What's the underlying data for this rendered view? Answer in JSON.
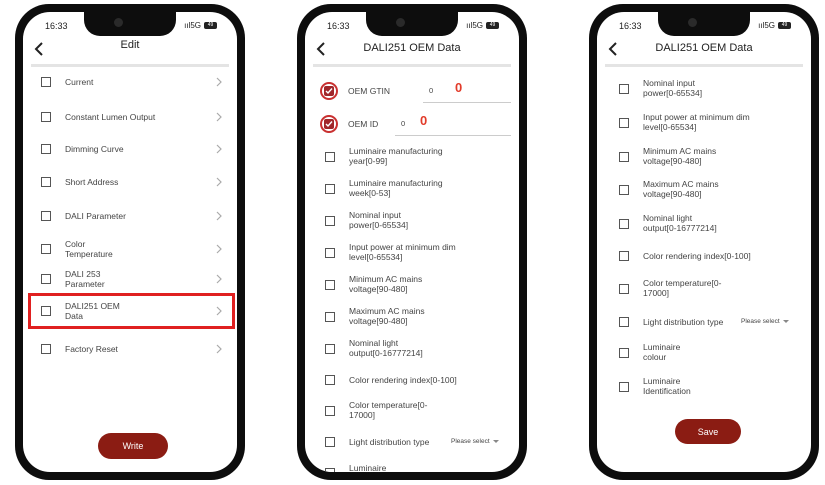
{
  "status": {
    "time": "16:33",
    "signal": "ııl5G",
    "battery": "49"
  },
  "phone1": {
    "title": "Edit",
    "items": [
      "Current",
      "Constant Lumen Output",
      "Dimming Curve",
      "Short Address",
      "DALI Parameter",
      "Color Temperature",
      "DALI 253 Parameter",
      "DALI251 OEM Data",
      "Factory Reset"
    ],
    "button": "Write"
  },
  "phone2": {
    "title": "DALI251 OEM Data",
    "oem_gtin_label": "OEM GTIN",
    "oem_gtin_value": "0",
    "oem_gtin_annotation": "0",
    "oem_id_label": "OEM ID",
    "oem_id_value": "0",
    "oem_id_annotation": "0",
    "items": [
      "Luminaire manufacturing year[0-99]",
      "Luminaire manufacturing week[0-53]",
      "Nominal input power[0-65534]",
      "Input power at minimum dim level[0-65534]",
      "Minimum AC mains voltage[90-480]",
      "Maximum AC mains voltage[90-480]",
      "Nominal light output[0-16777214]",
      "Color rendering index[0-100]",
      "Color temperature[0-17000]",
      "Light distribution type",
      "Luminaire"
    ],
    "select_placeholder": "Please select"
  },
  "phone3": {
    "title": "DALI251 OEM Data",
    "items": [
      "Nominal input power[0-65534]",
      "Input power at minimum dim level[0-65534]",
      "Minimum AC mains voltage[90-480]",
      "Maximum AC mains voltage[90-480]",
      "Nominal light output[0-16777214]",
      "Color rendering index[0-100]",
      "Color temperature[0-17000]",
      "Light distribution type",
      "Luminaire colour",
      "Luminaire Identification"
    ],
    "select_placeholder": "Please select",
    "button": "Save"
  },
  "colors": {
    "accent": "#8b1c13",
    "highlight": "#e02020",
    "annotation": "#e23b2a"
  }
}
